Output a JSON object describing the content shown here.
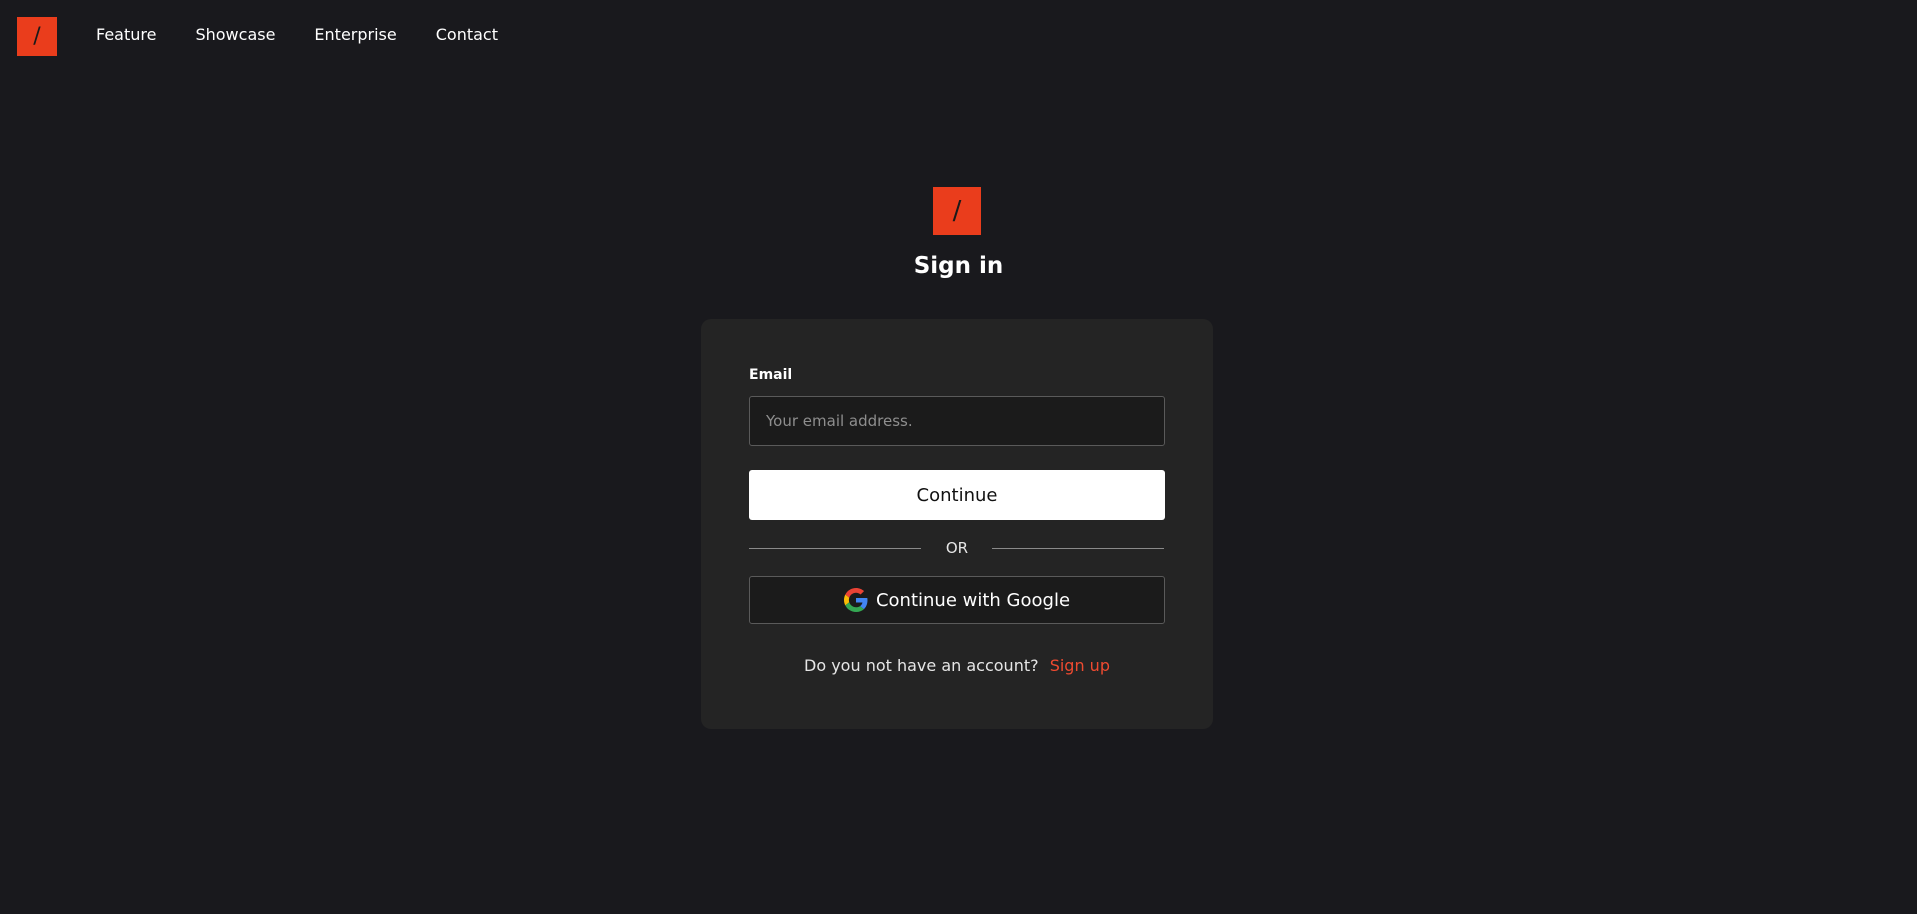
{
  "brand": {
    "logo_glyph": "/",
    "accent_color": "#ea3d1c"
  },
  "nav": {
    "items": [
      {
        "label": "Feature"
      },
      {
        "label": "Showcase"
      },
      {
        "label": "Enterprise"
      },
      {
        "label": "Contact"
      }
    ]
  },
  "signin": {
    "title": "Sign in",
    "email_label": "Email",
    "email_placeholder": "Your email address.",
    "email_value": "",
    "continue_label": "Continue",
    "divider_text": "OR",
    "google_label": "Continue with Google",
    "google_icon": "google-icon",
    "no_account_text": "Do you not have an account?",
    "signup_label": "Sign up",
    "signup_color": "#ef4a30"
  }
}
